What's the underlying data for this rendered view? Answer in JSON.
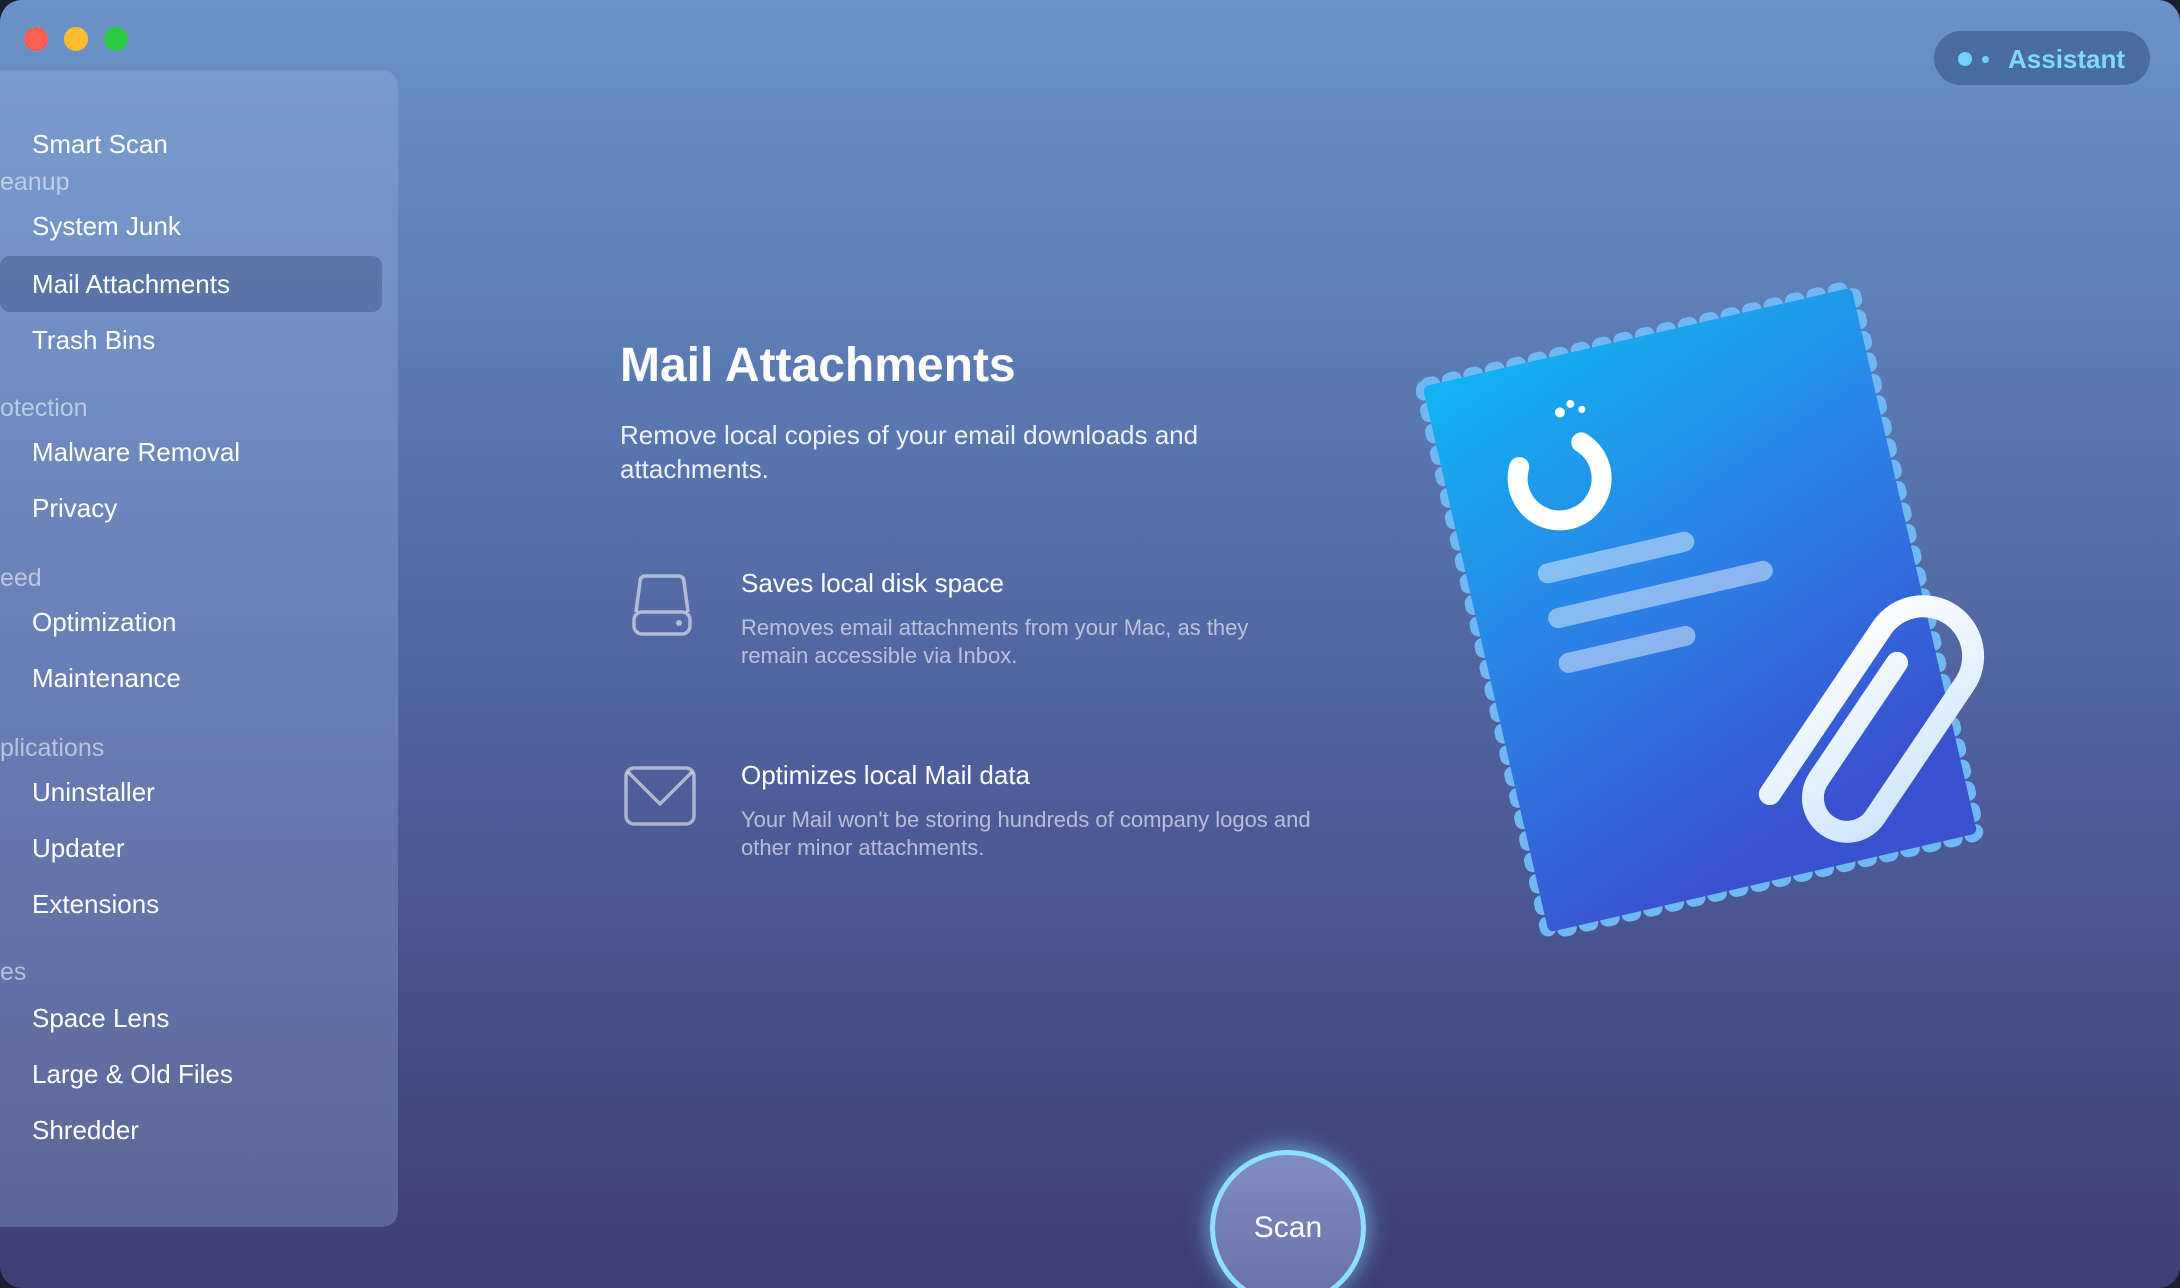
{
  "window": {
    "traffic_lights": [
      "close",
      "minimize",
      "maximize"
    ]
  },
  "assistant": {
    "label": "Assistant",
    "icon": "assistant-dots-icon",
    "color": "#7fd8ff"
  },
  "sidebar": {
    "items": [
      {
        "type": "item",
        "label": "Smart Scan",
        "icon": "smart-scan-icon"
      },
      {
        "type": "header",
        "label": "eanup"
      },
      {
        "type": "item",
        "label": "System Junk",
        "icon": "system-junk-icon"
      },
      {
        "type": "item",
        "label": "Mail Attachments",
        "icon": "mail-attachments-icon",
        "active": true
      },
      {
        "type": "item",
        "label": "Trash Bins",
        "icon": "trash-bins-icon"
      },
      {
        "type": "header",
        "label": "otection"
      },
      {
        "type": "item",
        "label": "Malware Removal",
        "icon": "malware-removal-icon"
      },
      {
        "type": "item",
        "label": "Privacy",
        "icon": "privacy-icon"
      },
      {
        "type": "header",
        "label": "eed"
      },
      {
        "type": "item",
        "label": "Optimization",
        "icon": "optimization-icon"
      },
      {
        "type": "item",
        "label": "Maintenance",
        "icon": "maintenance-icon"
      },
      {
        "type": "header",
        "label": "plications"
      },
      {
        "type": "item",
        "label": "Uninstaller",
        "icon": "uninstaller-icon"
      },
      {
        "type": "item",
        "label": "Updater",
        "icon": "updater-icon"
      },
      {
        "type": "item",
        "label": "Extensions",
        "icon": "extensions-icon"
      },
      {
        "type": "header",
        "label": "es"
      },
      {
        "type": "item",
        "label": "Space Lens",
        "icon": "space-lens-icon"
      },
      {
        "type": "item",
        "label": "Large & Old Files",
        "icon": "large-old-files-icon"
      },
      {
        "type": "item",
        "label": "Shredder",
        "icon": "shredder-icon"
      }
    ]
  },
  "main": {
    "title": "Mail Attachments",
    "subtitle": "Remove local copies of your email downloads and attachments.",
    "features": [
      {
        "icon": "disk-drive-icon",
        "title": "Saves local disk space",
        "description": "Removes email attachments from your Mac, as they remain accessible via Inbox."
      },
      {
        "icon": "envelope-icon",
        "title": "Optimizes local Mail data",
        "description": "Your Mail won't be storing hundreds of company logos and other minor attachments."
      }
    ],
    "illustration": "mail-attachment-stamp-illustration"
  },
  "scan_button": {
    "label": "Scan",
    "accent": "#8fe0ff"
  }
}
